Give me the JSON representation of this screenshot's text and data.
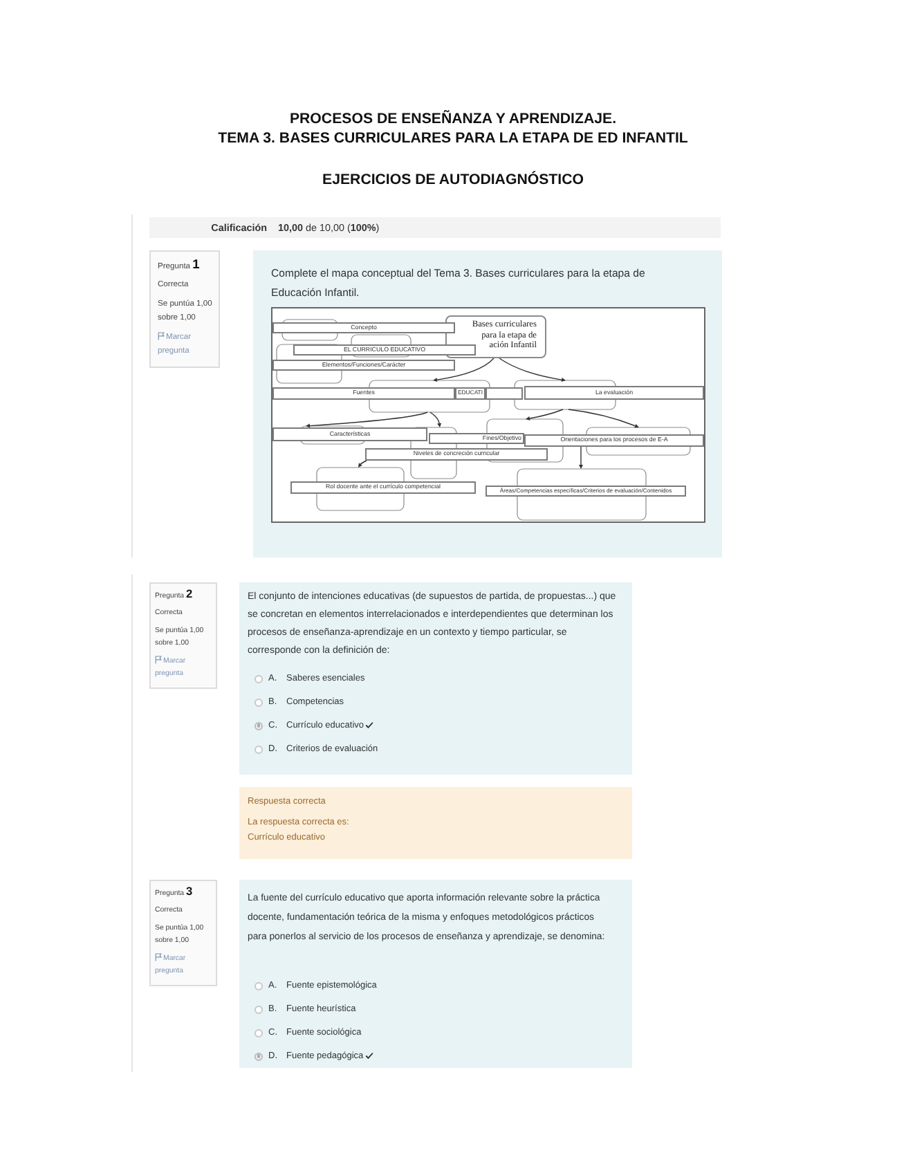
{
  "header": {
    "title_lines": [
      "PROCESOS DE ENSEÑANZA Y APRENDIZAJE.",
      "TEMA 3. BASES CURRICULARES PARA LA ETAPA DE ED INFANTIL"
    ],
    "subtitle": "EJERCICIOS DE AUTODIAGNÓSTICO"
  },
  "grade": {
    "label": "Calificación",
    "value": "**10,00** de 10,00 (**100%**)"
  },
  "questions": [
    {
      "kind": "concept_map",
      "heading": "Pregunta **1**",
      "status": "Correcta",
      "score": "Se puntúa 1,00 sobre 1,00",
      "flag": "Marcar pregunta",
      "prompt": "Complete el mapa conceptual del Tema 3. Bases curriculares para la etapa de Educación Infantil.",
      "map": {
        "title_lines": [
          "Bases curriculares",
          "para la etapa de",
          "ación Infantil"
        ],
        "labels": [
          "Concepto",
          "EL CURRICULO EDUCATIVO",
          "Elementos/Funciones/Carácter",
          "Fuentes",
          "EDUCATI",
          "La evaluación",
          "Características",
          "Fines/Objetivo",
          "Orientaciones para los procesos de E-A",
          "Niveles de concreción curricular",
          "Rol docente ante el currículo competencial",
          "Áreas/Competencias específicas/Criterios de evaluación/Contenidos"
        ]
      }
    },
    {
      "kind": "multiple_choice",
      "heading": "Pregunta **2**",
      "status": "Correcta",
      "score": "Se puntúa 1,00 sobre 1,00",
      "flag": "Marcar pregunta",
      "prompt": "El conjunto de intenciones educativas (de supuestos de partida, de propuestas...) que se concretan en elementos interrelacionados e interdependientes que determinan los procesos de enseñanza-aprendizaje en un contexto y tiempo particular, se corresponde con la definición de:",
      "options": [
        {
          "letter": "A.",
          "text": "Saberes esenciales",
          "selected": false,
          "correct": false
        },
        {
          "letter": "B.",
          "text": "Competencias",
          "selected": false,
          "correct": false
        },
        {
          "letter": "C.",
          "text": "Currículo educativo",
          "selected": true,
          "correct": true
        },
        {
          "letter": "D.",
          "text": "Criterios de evaluación",
          "selected": false,
          "correct": false
        }
      ],
      "feedback": {
        "title": "Respuesta correcta",
        "intro": "La respuesta correcta es:",
        "answer": "Currículo educativo"
      }
    },
    {
      "kind": "multiple_choice",
      "heading": "Pregunta **3**",
      "status": "Correcta",
      "score": "Se puntúa 1,00 sobre 1,00",
      "flag": "Marcar pregunta",
      "prompt": "La fuente del currículo educativo que aporta información relevante sobre la práctica docente, fundamentación teórica de la misma y enfoques metodológicos prácticos para ponerlos al servicio de los procesos de enseñanza y aprendizaje, se denomina:",
      "options": [
        {
          "letter": "A.",
          "text": "Fuente epistemológica",
          "selected": false,
          "correct": false
        },
        {
          "letter": "B.",
          "text": "Fuente heurística",
          "selected": false,
          "correct": false
        },
        {
          "letter": "C.",
          "text": "Fuente sociológica",
          "selected": false,
          "correct": false
        },
        {
          "letter": "D.",
          "text": "Fuente pedagógica",
          "selected": true,
          "correct": true
        }
      ]
    }
  ]
}
